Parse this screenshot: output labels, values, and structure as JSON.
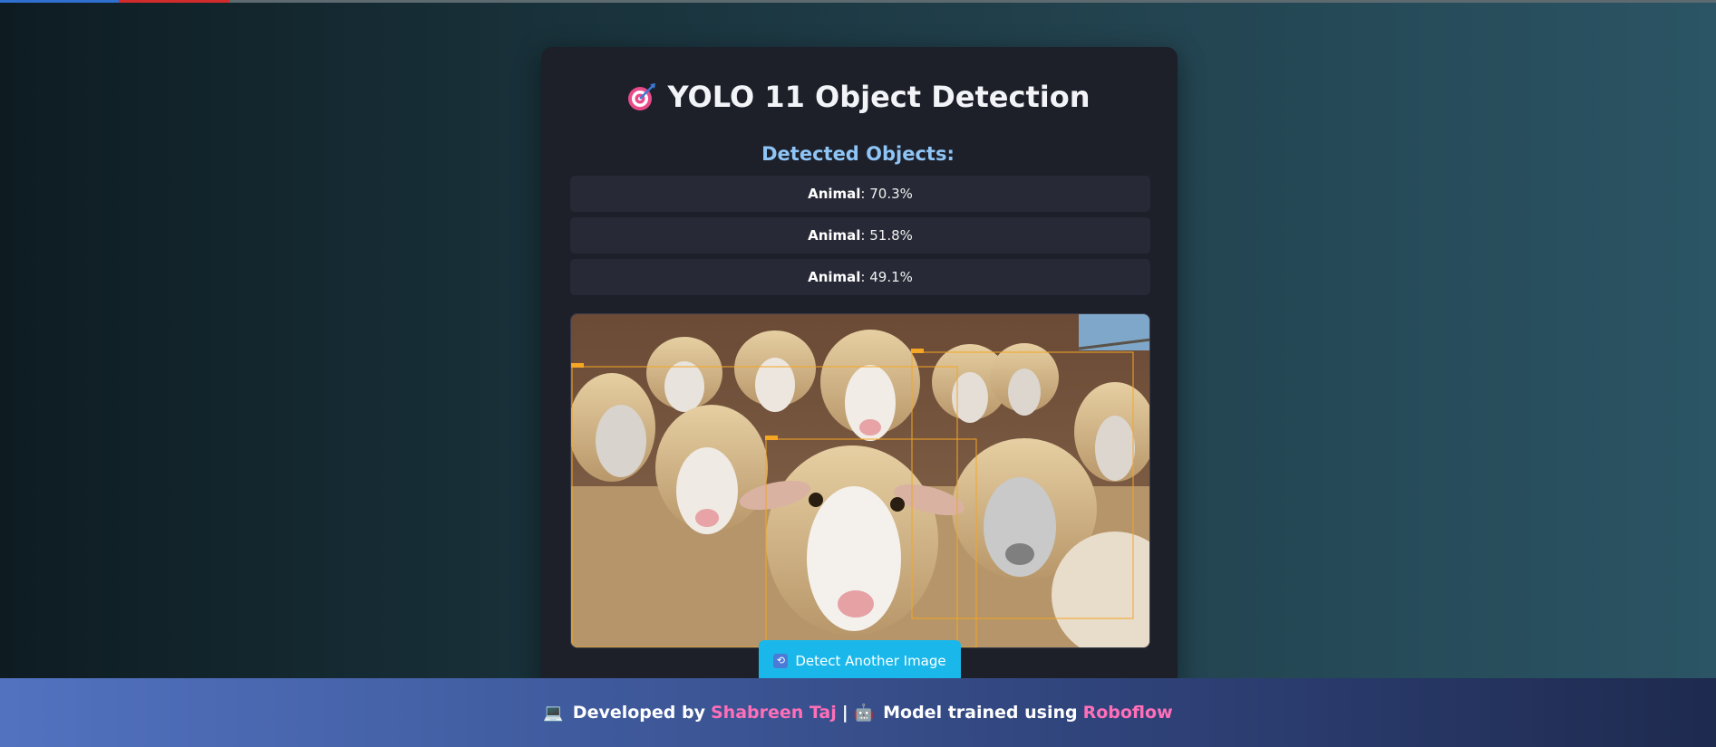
{
  "app": {
    "title": "YOLO 11 Object Detection",
    "title_icon": "target-icon"
  },
  "detections": {
    "heading": "Detected Objects:",
    "items": [
      {
        "label": "Animal",
        "confidence": "70.3%"
      },
      {
        "label": "Animal",
        "confidence": "51.8%"
      },
      {
        "label": "Animal",
        "confidence": "49.1%"
      }
    ]
  },
  "result_image": {
    "subject": "sheep",
    "box_color": "#f5a623"
  },
  "actions": {
    "detect_again_label": "Detect Another Image",
    "detect_again_icon": "repeat-icon"
  },
  "footer": {
    "developed_by_label": "Developed by",
    "developer_name": "Shabreen Taj",
    "separator": "|",
    "model_label": "Model trained using",
    "model_tool": "Roboflow",
    "laptop_icon": "laptop-icon",
    "robot_icon": "robot-icon",
    "accent_color": "#ff6fb8"
  },
  "colors": {
    "card_bg": "#1d1f29",
    "heading_blue": "#8ec5f5",
    "button_bg": "#1ab8ea"
  }
}
